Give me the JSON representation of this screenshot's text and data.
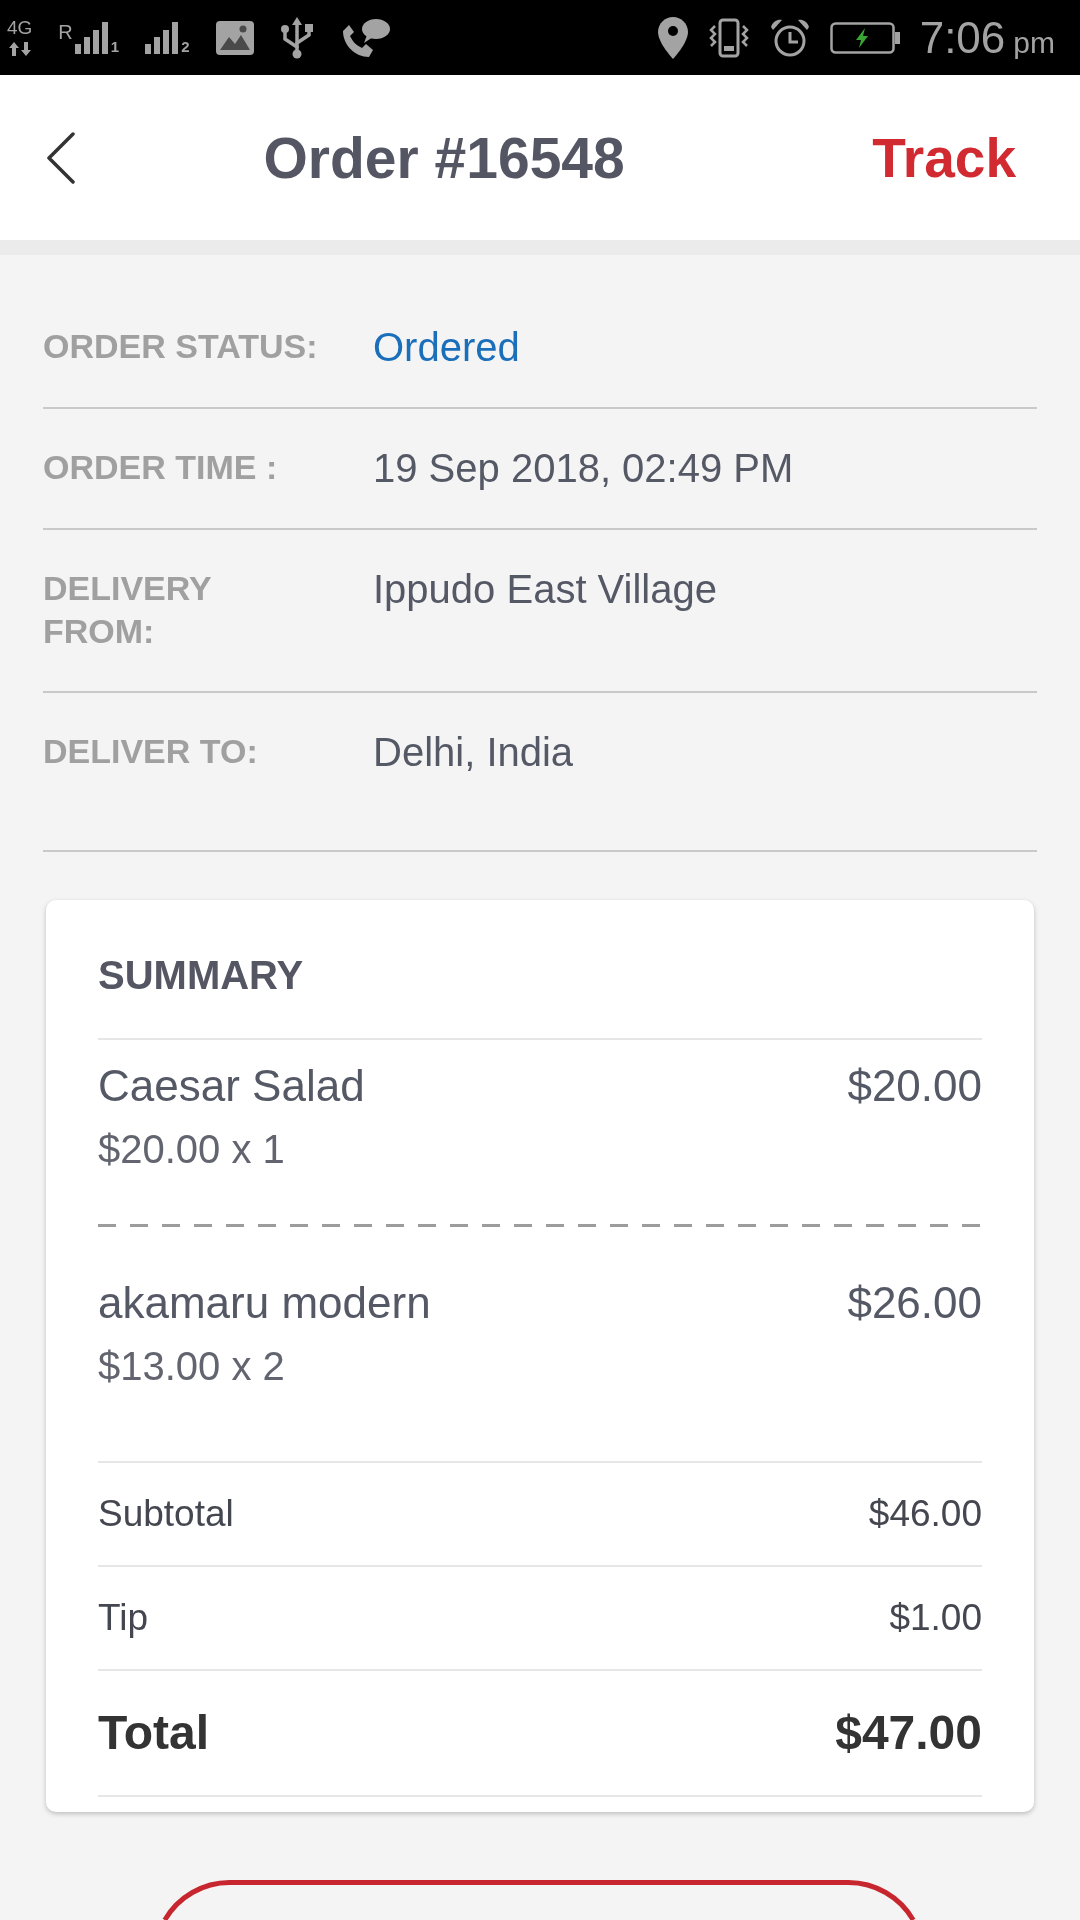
{
  "status_bar": {
    "network": "4G",
    "sims": [
      {
        "roaming": "R",
        "label": "1"
      },
      {
        "label": "2"
      }
    ],
    "time": "7:06",
    "period": "pm"
  },
  "header": {
    "title": "Order #16548",
    "action": "Track"
  },
  "details": [
    {
      "label": "ORDER STATUS:",
      "value": "Ordered",
      "kind": "status"
    },
    {
      "label": "ORDER TIME :",
      "value": "19 Sep 2018, 02:49 PM",
      "kind": "text"
    },
    {
      "label": "DELIVERY FROM:",
      "value": "Ippudo East Village",
      "kind": "text"
    },
    {
      "label": "DELIVER TO:",
      "value": "Delhi, India",
      "kind": "text"
    }
  ],
  "summary": {
    "title": "SUMMARY",
    "items": [
      {
        "name": "Caesar Salad",
        "price_line": "$20.00 x 1",
        "amount": "$20.00"
      },
      {
        "name": "akamaru modern",
        "price_line": "$13.00 x 2",
        "amount": "$26.00"
      }
    ],
    "totals": [
      {
        "label": "Subtotal",
        "amount": "$46.00",
        "kind": "line"
      },
      {
        "label": "Tip",
        "amount": "$1.00",
        "kind": "line"
      },
      {
        "label": "Total",
        "amount": "$47.00",
        "kind": "grand"
      }
    ]
  },
  "bottom_button": {
    "kind": "outline"
  }
}
